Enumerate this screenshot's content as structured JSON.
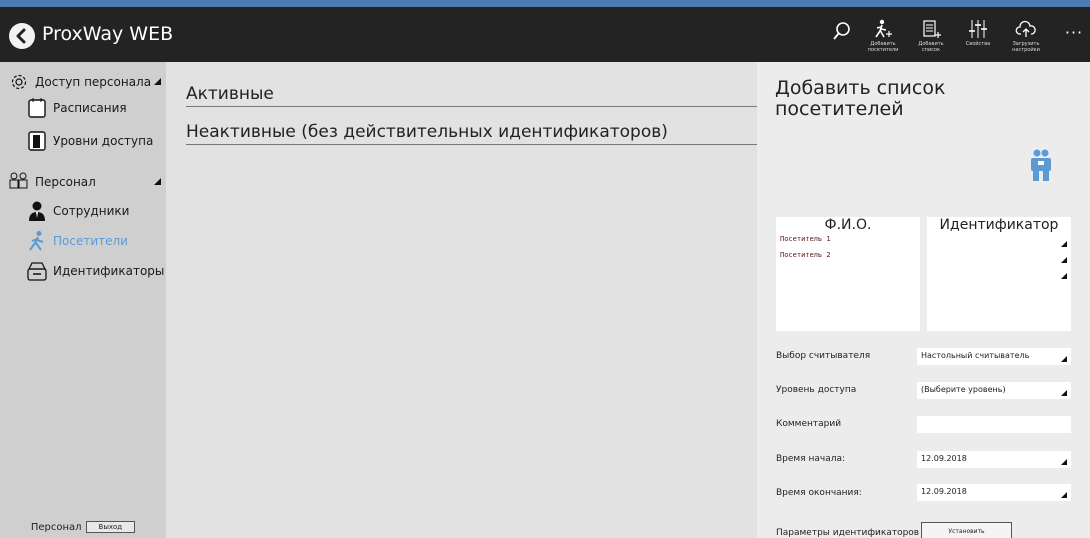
{
  "titlebar": {
    "title": "ProxWay WEB",
    "back_icon": "back-arrow-icon",
    "toolbar": [
      {
        "name": "search",
        "icon": "search-icon",
        "label": ""
      },
      {
        "name": "add-visitors",
        "icon": "add-visitor-icon",
        "label": "Добавить\nпосетители"
      },
      {
        "name": "add-list",
        "icon": "add-list-icon",
        "label": "Добавить\nсписок"
      },
      {
        "name": "properties",
        "icon": "sliders-icon",
        "label": "Свойства"
      },
      {
        "name": "load-settings",
        "icon": "cloud-upload-icon",
        "label": "Загрузить\nнастройки"
      },
      {
        "name": "more",
        "icon": "more-icon",
        "label": ""
      }
    ]
  },
  "sidebar": {
    "groups": [
      {
        "label": "Доступ персонала",
        "icon": "gear-icon"
      },
      {
        "label": "Персонал",
        "icon": "people-icon"
      }
    ],
    "items": [
      {
        "label": "Расписания",
        "icon": "calendar-icon"
      },
      {
        "label": "Уровни доступа",
        "icon": "door-icon"
      },
      {
        "label": "Сотрудники",
        "icon": "employee-icon"
      },
      {
        "label": "Посетители",
        "icon": "visitor-icon"
      },
      {
        "label": "Идентификаторы",
        "icon": "card-reader-icon"
      }
    ],
    "footer": {
      "label": "Персонал",
      "exit": "Выход"
    }
  },
  "main": {
    "sections": [
      "Активные",
      "Неактивные (без действительных идентификаторов)"
    ]
  },
  "panel": {
    "title": "Добавить список посетителей",
    "columns": {
      "name": "Ф.И.О.",
      "id": "Идентификатор"
    },
    "rows": [
      "Посетитель 1",
      "Посетитель 2"
    ],
    "fields": {
      "reader": {
        "label": "Выбор считывателя",
        "value": "Настольный считыватель"
      },
      "level": {
        "label": "Уровень доступа",
        "value": "(Выберите уровень)"
      },
      "comment": {
        "label": "Комментарий",
        "value": ""
      },
      "start": {
        "label": "Время начала:",
        "value": "12.09.2018"
      },
      "end": {
        "label": "Время окончания:",
        "value": "12.09.2018"
      },
      "id_params": {
        "label": "Параметры идентификаторов",
        "button": "Установить"
      }
    },
    "accent_color": "#5b9bd5"
  }
}
